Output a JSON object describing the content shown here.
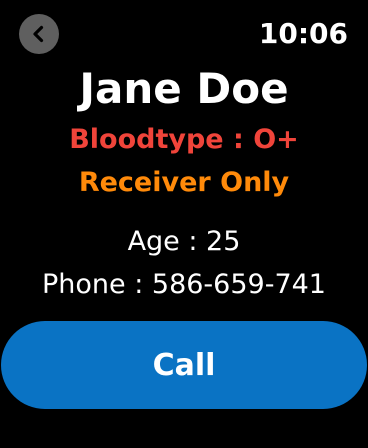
{
  "status_bar": {
    "time": "10:06",
    "back_icon": "chevron-left-icon"
  },
  "profile": {
    "name": "Jane Doe",
    "bloodtype": "Bloodtype : O+",
    "donor_status": "Receiver Only",
    "age": "Age : 25",
    "phone": "Phone : 586-659-741"
  },
  "actions": {
    "call_label": "Call"
  },
  "colors": {
    "background": "#000000",
    "bloodtype": "#f0443a",
    "donor_status": "#ff8a0a",
    "call_button": "#0a73c4",
    "back_button": "#5f5f5f"
  }
}
